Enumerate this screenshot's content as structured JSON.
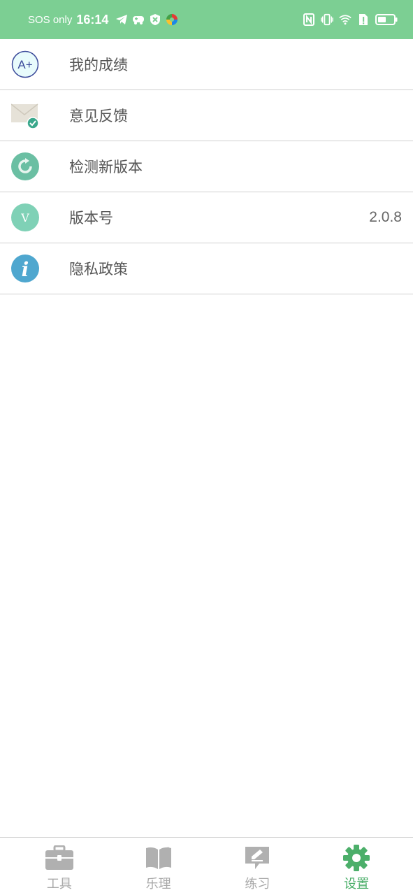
{
  "status_bar": {
    "carrier": "SOS only",
    "time": "16:14",
    "left_icons": [
      "telegram-icon",
      "game-controller-icon",
      "shield-icon",
      "browser-icon"
    ],
    "right_icons": [
      "nfc-icon",
      "vibrate-icon",
      "wifi-icon",
      "sim-alert-icon",
      "battery-icon"
    ],
    "background": "#7ccf93"
  },
  "menu": {
    "items": [
      {
        "label": "我的成绩",
        "icon": "grade-a-plus-icon",
        "value": ""
      },
      {
        "label": "意见反馈",
        "icon": "mail-check-icon",
        "value": ""
      },
      {
        "label": "检测新版本",
        "icon": "refresh-icon",
        "value": ""
      },
      {
        "label": "版本号",
        "icon": "version-v-icon",
        "value": "2.0.8"
      },
      {
        "label": "隐私政策",
        "icon": "info-icon",
        "value": ""
      }
    ]
  },
  "tab_bar": {
    "tabs": [
      {
        "label": "工具",
        "icon": "toolbox-icon",
        "active": false
      },
      {
        "label": "乐理",
        "icon": "book-icon",
        "active": false
      },
      {
        "label": "练习",
        "icon": "edit-note-icon",
        "active": false
      },
      {
        "label": "设置",
        "icon": "gear-icon",
        "active": true
      }
    ],
    "active_color": "#4caf6a",
    "inactive_color": "#a9a9a9"
  }
}
